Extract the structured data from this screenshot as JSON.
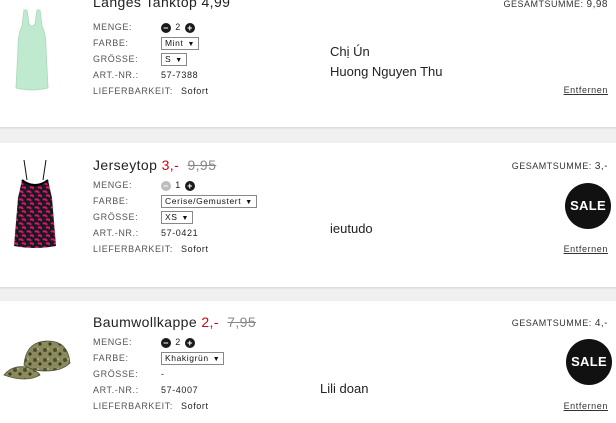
{
  "items": [
    {
      "name": "Langes Tanktop",
      "price": "4,99",
      "old_price": "",
      "total_label": "GESAMTSUMME:",
      "total_value": "9,98",
      "qty_label": "MENGE:",
      "qty_value": "2",
      "color_label": "FARBE:",
      "color_value": "Mint",
      "size_label": "GRÖSSE:",
      "size_value": "S",
      "art_label": "ART.-NR.:",
      "art_value": "57-7388",
      "avail_label": "LIEFERBARKEIT:",
      "avail_value": "Sofort",
      "remove": "Entfernen",
      "note_lines": [
        "Chị Ún",
        "Huong Nguyen Thu"
      ],
      "sale": ""
    },
    {
      "name": "Jerseytop",
      "price": "3,-",
      "old_price": "9,95",
      "total_label": "GESAMTSUMME:",
      "total_value": "3,-",
      "qty_label": "MENGE:",
      "qty_value": "1",
      "color_label": "FARBE:",
      "color_value": "Cerise/Gemustert",
      "size_label": "GRÖSSE:",
      "size_value": "XS",
      "art_label": "ART.-NR.:",
      "art_value": "57-0421",
      "avail_label": "LIEFERBARKEIT:",
      "avail_value": "Sofort",
      "remove": "Entfernen",
      "note_lines": [
        "ieutudo"
      ],
      "sale": "SALE"
    },
    {
      "name": "Baumwollkappe",
      "price": "2,-",
      "old_price": "7,95",
      "total_label": "GESAMTSUMME:",
      "total_value": "4,-",
      "qty_label": "MENGE:",
      "qty_value": "2",
      "color_label": "FARBE:",
      "color_value": "Khakigrün",
      "size_label": "GRÖSSE:",
      "size_value": "-",
      "art_label": "ART.-NR.:",
      "art_value": "57-4007",
      "avail_label": "LIEFERBARKEIT:",
      "avail_value": "Sofort",
      "remove": "Entfernen",
      "note_lines": [
        "Lili doan"
      ],
      "sale": "SALE"
    }
  ],
  "colors": {
    "sale_price": "#d0021b",
    "background": "#f0f0f0",
    "badge": "#111111"
  },
  "icons": {
    "minus": "minus-circle-icon",
    "plus": "plus-circle-icon",
    "dropdown": "triangle-down-icon"
  }
}
